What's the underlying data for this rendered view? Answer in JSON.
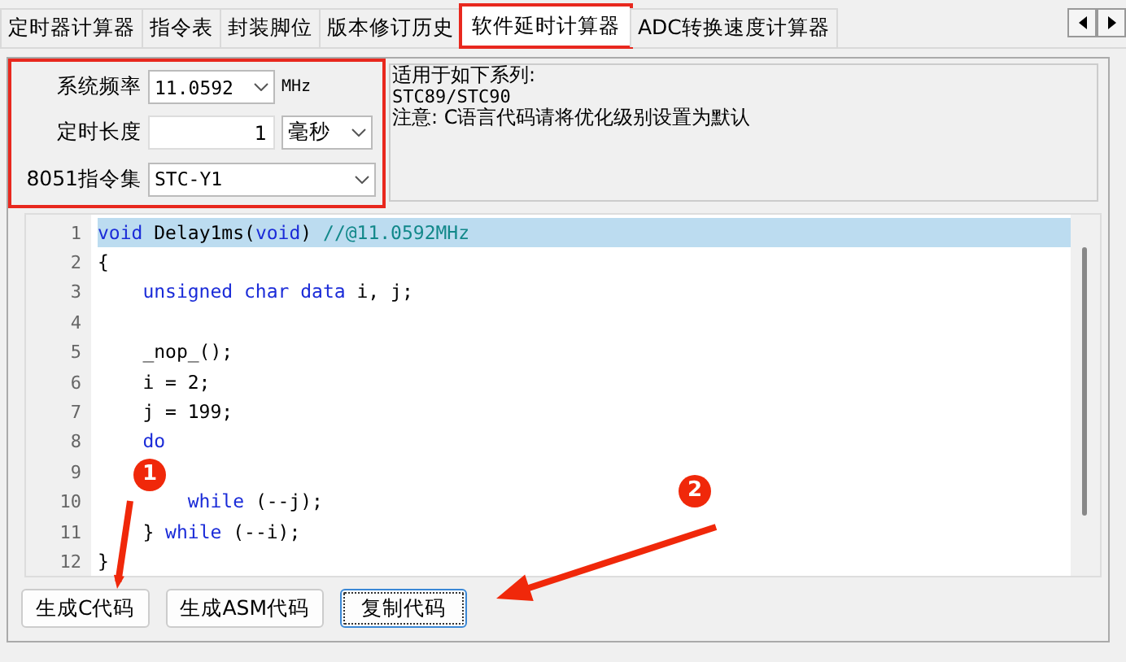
{
  "tabs": [
    {
      "label": "定时器计算器",
      "selected": false,
      "annotated": false
    },
    {
      "label": "指令表",
      "selected": false,
      "annotated": false
    },
    {
      "label": "封装脚位",
      "selected": false,
      "annotated": false
    },
    {
      "label": "版本修订历史",
      "selected": false,
      "annotated": false
    },
    {
      "label": "软件延时计算器",
      "selected": true,
      "annotated": true
    },
    {
      "label": "ADC转换速度计算器",
      "selected": false,
      "annotated": false
    }
  ],
  "settings": {
    "annotated": true,
    "fields": [
      {
        "label": "系统频率",
        "kind": "select",
        "value": "11.0592",
        "unit": {
          "kind": "label",
          "text": "MHz"
        }
      },
      {
        "label": "定时长度",
        "kind": "text",
        "value": "1",
        "unit": {
          "kind": "select",
          "text": "毫秒"
        }
      },
      {
        "label": "8051指令集",
        "kind": "select-wide",
        "value": "STC-Y1"
      }
    ]
  },
  "info": [
    "适用于如下系列:",
    "STC89/STC90",
    "注意: C语言代码请将优化级别设置为默认"
  ],
  "code": [
    {
      "number": "1",
      "selected": true,
      "tokens": [
        {
          "kind": "keyword",
          "text": "void"
        },
        {
          "kind": "plain",
          "text": " Delay1ms("
        },
        {
          "kind": "keyword",
          "text": "void"
        },
        {
          "kind": "plain",
          "text": ") "
        },
        {
          "kind": "comment",
          "text": "//@11.0592MHz"
        }
      ]
    },
    {
      "number": "2",
      "selected": false,
      "tokens": [
        {
          "kind": "plain",
          "text": "{"
        }
      ]
    },
    {
      "number": "3",
      "selected": false,
      "tokens": [
        {
          "kind": "keyword",
          "text": "    unsigned char data"
        },
        {
          "kind": "plain",
          "text": " i, j;"
        }
      ]
    },
    {
      "number": "4",
      "selected": false
    },
    {
      "number": "5",
      "selected": false,
      "tokens": [
        {
          "kind": "plain",
          "text": "    _nop_();"
        }
      ]
    },
    {
      "number": "6",
      "selected": false,
      "tokens": [
        {
          "kind": "plain",
          "text": "    i = 2;"
        }
      ]
    },
    {
      "number": "7",
      "selected": false,
      "tokens": [
        {
          "kind": "plain",
          "text": "    j = 199;"
        }
      ]
    },
    {
      "number": "8",
      "selected": false,
      "tokens": [
        {
          "kind": "keyword",
          "text": "    do"
        }
      ]
    },
    {
      "number": "9",
      "selected": false
    },
    {
      "number": "10",
      "selected": false,
      "tokens": [
        {
          "kind": "keyword",
          "text": "        while"
        },
        {
          "kind": "plain",
          "text": " (--j);"
        }
      ]
    },
    {
      "number": "11",
      "selected": false,
      "tokens": [
        {
          "kind": "plain",
          "text": "    } "
        },
        {
          "kind": "keyword",
          "text": "while"
        },
        {
          "kind": "plain",
          "text": " (--i);"
        }
      ]
    },
    {
      "number": "12",
      "selected": false,
      "tokens": [
        {
          "kind": "plain",
          "text": "}"
        }
      ]
    }
  ],
  "buttons": [
    {
      "label": "生成C代码",
      "focused": false
    },
    {
      "label": "生成ASM代码",
      "focused": false
    },
    {
      "label": "复制代码",
      "focused": true
    }
  ],
  "markers": [
    {
      "label": "1"
    },
    {
      "label": "2"
    }
  ]
}
